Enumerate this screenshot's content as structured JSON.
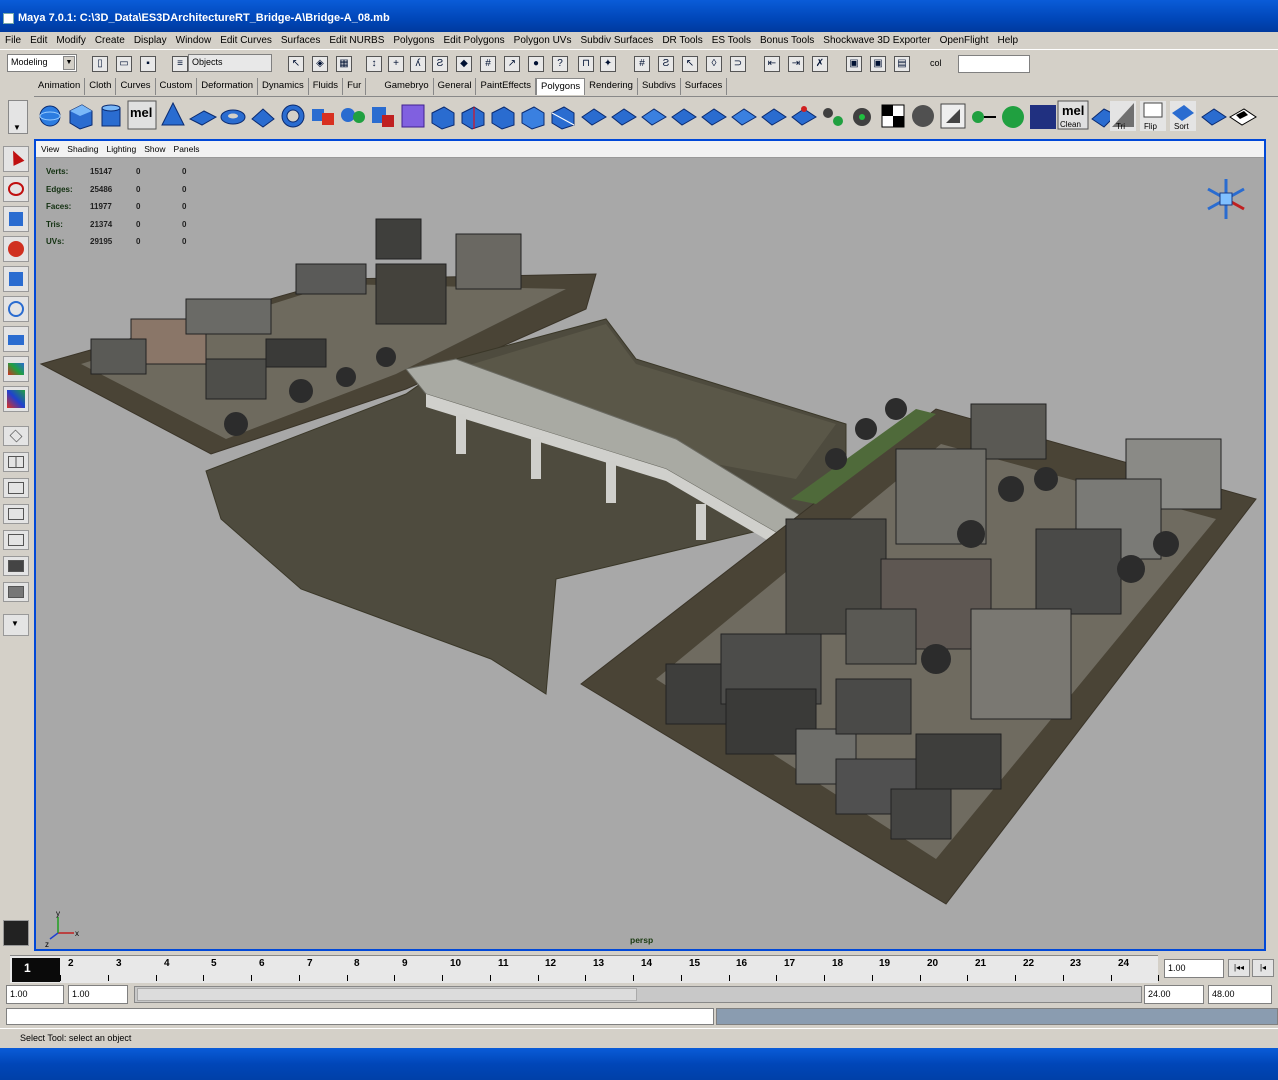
{
  "window": {
    "title": "Maya 7.0.1: C:\\3D_Data\\ES3DArchitectureRT_Bridge-A\\Bridge-A_08.mb"
  },
  "menu": [
    "File",
    "Edit",
    "Modify",
    "Create",
    "Display",
    "Window",
    "Edit Curves",
    "Surfaces",
    "Edit NURBS",
    "Polygons",
    "Edit Polygons",
    "Polygon UVs",
    "Subdiv Surfaces",
    "DR Tools",
    "ES Tools",
    "Bonus Tools",
    "Shockwave 3D Exporter",
    "OpenFlight",
    "Help"
  ],
  "statusline": {
    "mode": "Modeling",
    "selection_mask": "Objects",
    "camera_field_label": "col"
  },
  "shelf_tabs": [
    "Animation",
    "Cloth",
    "Curves",
    "Custom",
    "Deformation",
    "Dynamics",
    "Fluids",
    "Fur",
    "Gamebryo",
    "General",
    "PaintEffects",
    "Polygons",
    "Rendering",
    "Subdivs",
    "Surfaces"
  ],
  "active_shelf_tab": "Polygons",
  "shelf_icon_text": {
    "mel1": "mel",
    "mel2": "mel",
    "mel2_sub": "Clean",
    "tri": "Tri",
    "flip": "Flip",
    "sort": "Sort"
  },
  "colors": {
    "title_bar": "#0a5cd8",
    "viewport_border": "#0048d8",
    "viewport_bg": "#a8a8a8"
  },
  "viewport": {
    "menu": [
      "View",
      "Shading",
      "Lighting",
      "Show",
      "Panels"
    ],
    "hud": [
      {
        "label": "Verts:",
        "value": "15147",
        "sel": "0",
        "comp": "0"
      },
      {
        "label": "Edges:",
        "value": "25486",
        "sel": "0",
        "comp": "0"
      },
      {
        "label": "Faces:",
        "value": "11977",
        "sel": "0",
        "comp": "0"
      },
      {
        "label": "Tris:",
        "value": "21374",
        "sel": "0",
        "comp": "0"
      },
      {
        "label": "UVs:",
        "value": "29195",
        "sel": "0",
        "comp": "0"
      }
    ],
    "camera": "persp",
    "axis_x": "x",
    "axis_y": "y",
    "axis_z": "z"
  },
  "timeline": {
    "current_frame": "1",
    "ticks": [
      "2",
      "3",
      "4",
      "5",
      "6",
      "7",
      "8",
      "9",
      "10",
      "11",
      "12",
      "13",
      "14",
      "15",
      "16",
      "17",
      "18",
      "19",
      "20",
      "21",
      "22",
      "23",
      "24"
    ],
    "current_time_field": "1.00"
  },
  "range": {
    "start": "1.00",
    "playback_start": "1.00",
    "playback_end": "24.00",
    "end": "48.00"
  },
  "help_line": "Select Tool: select an object"
}
